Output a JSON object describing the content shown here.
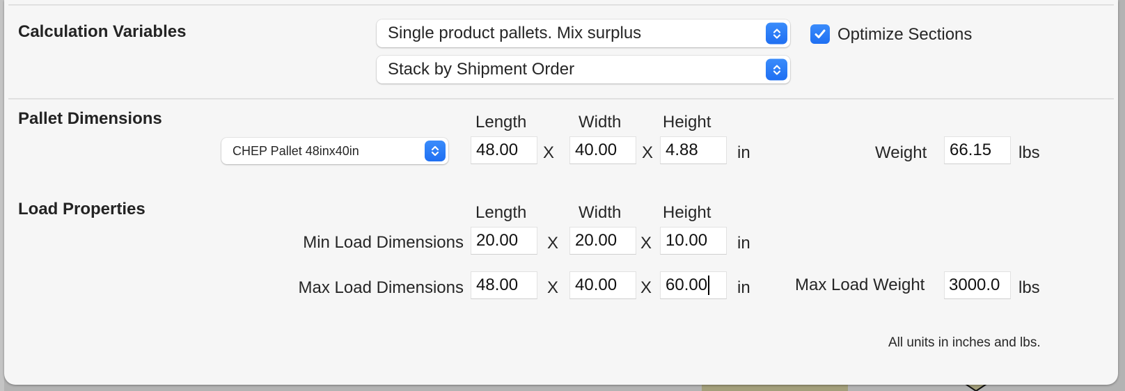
{
  "calculation_variables": {
    "title": "Calculation Variables",
    "packing_mode": {
      "selected": "Single product pallets. Mix surplus"
    },
    "stacking_order": {
      "selected": "Stack by Shipment Order"
    },
    "optimize_sections": {
      "label": "Optimize Sections",
      "checked": true
    }
  },
  "pallet_dimensions": {
    "title": "Pallet Dimensions",
    "pallet_type": {
      "selected": "CHEP Pallet 48inx40in"
    },
    "headers": {
      "length": "Length",
      "width": "Width",
      "height": "Height"
    },
    "length": "48.00",
    "width": "40.00",
    "height": "4.88",
    "times_symbol": "X",
    "unit": "in",
    "weight_label": "Weight",
    "weight": "66.15",
    "weight_unit": "lbs"
  },
  "load_properties": {
    "title": "Load Properties",
    "headers": {
      "length": "Length",
      "width": "Width",
      "height": "Height"
    },
    "min": {
      "label": "Min Load Dimensions",
      "length": "20.00",
      "width": "20.00",
      "height": "10.00"
    },
    "max": {
      "label": "Max Load Dimensions",
      "length": "48.00",
      "width": "40.00",
      "height": "60.00"
    },
    "times_symbol": "X",
    "unit": "in",
    "max_weight_label": "Max Load Weight",
    "max_weight": "3000.0",
    "weight_unit": "lbs"
  },
  "footnote": "All units in inches and lbs.",
  "colors": {
    "accent": "#2479f6",
    "sheet_bg": "#f6f6f6",
    "separator": "#e0e0e0"
  }
}
